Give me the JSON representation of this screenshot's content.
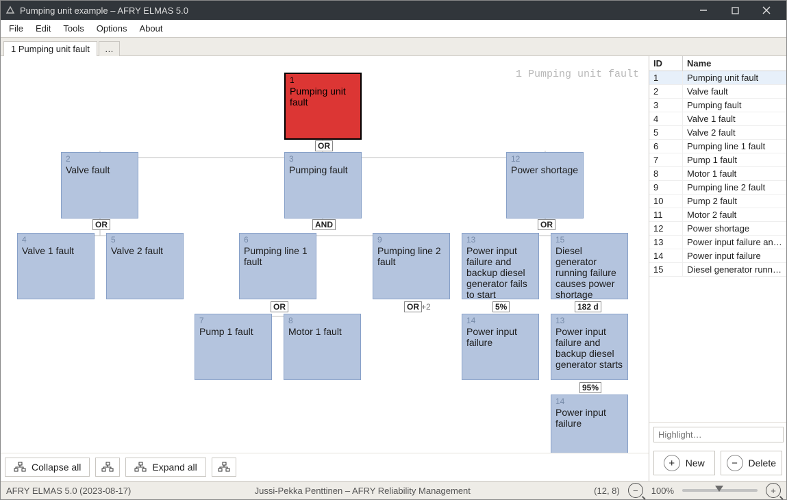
{
  "window": {
    "title": "Pumping unit example – AFRY ELMAS 5.0"
  },
  "menu": {
    "file": "File",
    "edit": "Edit",
    "tools": "Tools",
    "options": "Options",
    "about": "About"
  },
  "tabs": {
    "t1": "1 Pumping unit fault",
    "t2": "…"
  },
  "breadcrumb": "1 Pumping unit fault",
  "gates": {
    "or": "OR",
    "and": "AND"
  },
  "plus2": "+2",
  "annot": {
    "five": "5%",
    "d182": "182 d",
    "p95": "95%"
  },
  "nodes": {
    "n1": {
      "id": "1",
      "txt": "Pumping unit fault"
    },
    "n2": {
      "id": "2",
      "txt": "Valve fault"
    },
    "n3": {
      "id": "3",
      "txt": "Pumping fault"
    },
    "n12": {
      "id": "12",
      "txt": "Power shortage"
    },
    "n4": {
      "id": "4",
      "txt": "Valve 1 fault"
    },
    "n5": {
      "id": "5",
      "txt": "Valve 2 fault"
    },
    "n6": {
      "id": "6",
      "txt": "Pumping line 1 fault"
    },
    "n9": {
      "id": "9",
      "txt": "Pumping line 2 fault"
    },
    "n13a": {
      "id": "13",
      "txt": "Power input failure and backup diesel generator  fails to start"
    },
    "n15": {
      "id": "15",
      "txt": "Diesel generator running failure causes power shortage"
    },
    "n7": {
      "id": "7",
      "txt": "Pump 1 fault"
    },
    "n8": {
      "id": "8",
      "txt": "Motor 1 fault"
    },
    "n14a": {
      "id": "14",
      "txt": "Power input failure"
    },
    "n13b": {
      "id": "13",
      "txt": "Power input failure and backup diesel generator  starts"
    },
    "n14b": {
      "id": "14",
      "txt": "Power input failure"
    }
  },
  "toolbar": {
    "collapse": "Collapse all",
    "expand": "Expand all"
  },
  "rightpanel": {
    "head": {
      "id": "ID",
      "name": "Name"
    },
    "rows": [
      {
        "id": "1",
        "name": "Pumping unit fault",
        "sel": true
      },
      {
        "id": "2",
        "name": "Valve fault"
      },
      {
        "id": "3",
        "name": "Pumping fault"
      },
      {
        "id": "4",
        "name": "Valve 1 fault"
      },
      {
        "id": "5",
        "name": "Valve 2 fault"
      },
      {
        "id": "6",
        "name": "Pumping line 1 fault"
      },
      {
        "id": "7",
        "name": "Pump 1 fault"
      },
      {
        "id": "8",
        "name": "Motor 1 fault"
      },
      {
        "id": "9",
        "name": "Pumping line 2 fault"
      },
      {
        "id": "10",
        "name": "Pump 2 fault"
      },
      {
        "id": "11",
        "name": "Motor 2 fault"
      },
      {
        "id": "12",
        "name": "Power shortage"
      },
      {
        "id": "13",
        "name": "Power input failure and bac..."
      },
      {
        "id": "14",
        "name": "Power input failure"
      },
      {
        "id": "15",
        "name": "Diesel generator running fail..."
      }
    ],
    "highlight_placeholder": "Highlight…",
    "new": "New",
    "delete": "Delete"
  },
  "status": {
    "version": "AFRY ELMAS 5.0 (2023-08-17)",
    "author": "Jussi-Pekka Penttinen – AFRY Reliability Management",
    "coords": "(12, 8)",
    "zoom": "100%"
  }
}
